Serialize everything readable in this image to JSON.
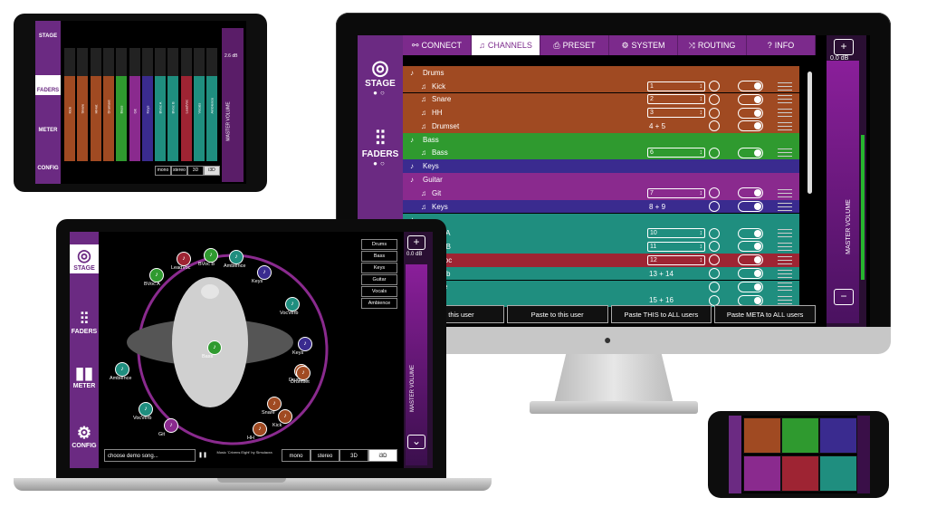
{
  "colors": {
    "purple": "#6b2a82",
    "drums": "#a04a22",
    "bass": "#2f9a2f",
    "keys": "#3a2b8f",
    "guitar": "#8a2a8e",
    "vocals": "#1f8e7f",
    "leadvoc": "#9e2433",
    "meter_green": "#27b32f"
  },
  "desktop": {
    "sidebar": [
      {
        "label": "STAGE",
        "icon": "target-icon"
      },
      {
        "label": "FADERS",
        "icon": "sliders-icon"
      }
    ],
    "tabs": [
      {
        "label": "CONNECT",
        "icon": "link-icon",
        "active": false
      },
      {
        "label": "CHANNELS",
        "icon": "music-icon",
        "active": true
      },
      {
        "label": "PRESET",
        "icon": "save-icon",
        "active": false
      },
      {
        "label": "SYSTEM",
        "icon": "gear-icon",
        "active": false
      },
      {
        "label": "ROUTING",
        "icon": "shuffle-icon",
        "active": false
      },
      {
        "label": "INFO",
        "icon": "help-icon",
        "active": false
      }
    ],
    "rows": [
      {
        "kind": "group",
        "name": "Drums",
        "color": "#a04a22"
      },
      {
        "kind": "sub",
        "name": "Kick",
        "color": "#a04a22",
        "sel": "1"
      },
      {
        "kind": "sub",
        "name": "Snare",
        "color": "#a04a22",
        "sel": "2"
      },
      {
        "kind": "sub",
        "name": "HH",
        "color": "#a04a22",
        "sel": "3"
      },
      {
        "kind": "sub",
        "name": "Drumset",
        "color": "#a04a22",
        "pair": "4 + 5"
      },
      {
        "kind": "group",
        "name": "Bass",
        "color": "#2f9a2f"
      },
      {
        "kind": "sub",
        "name": "Bass",
        "color": "#2f9a2f",
        "sel": "6"
      },
      {
        "kind": "group",
        "name": "Keys",
        "color": "#3a2b8f"
      },
      {
        "kind": "group",
        "name": "Guitar",
        "color": "#8a2a8e"
      },
      {
        "kind": "sub",
        "name": "Git",
        "color": "#8a2a8e",
        "sel": "7"
      },
      {
        "kind": "sub",
        "name": "Keys",
        "color": "#3a2b8f",
        "pair": "8 + 9"
      },
      {
        "kind": "group",
        "name": "",
        "color": "#1f8e7f"
      },
      {
        "kind": "sub",
        "name": "Voc A",
        "color": "#1f8e7f",
        "sel": "10"
      },
      {
        "kind": "sub",
        "name": "Voc B",
        "color": "#1f8e7f",
        "sel": "11"
      },
      {
        "kind": "sub",
        "name": "adVoc",
        "color": "#9e2433",
        "sel": "12"
      },
      {
        "kind": "sub",
        "name": "cVerb",
        "color": "#1f8e7f",
        "pair": "13 + 14"
      },
      {
        "kind": "sub",
        "name": "ence",
        "color": "#1f8e7f"
      },
      {
        "kind": "sub",
        "name": "",
        "color": "#1f8e7f",
        "pair": "15 + 16"
      }
    ],
    "paste_buttons": [
      "from this user",
      "Paste to this user",
      "Paste THIS to ALL users",
      "Paste META to ALL users"
    ],
    "master": {
      "db": "0.0 dB",
      "label": "MASTER VOLUME",
      "level": 0.9
    }
  },
  "tablet": {
    "sidebar": [
      "STAGE",
      "FADERS",
      "METER",
      "CONFIG"
    ],
    "modes": [
      "mono",
      "stereo",
      "3D",
      "i3D"
    ],
    "master_label": "MASTER VOLUME",
    "master_db": "2.6 dB",
    "channels": [
      "Kick",
      "Snare",
      "HiHat",
      "Drumset",
      "Bass",
      "Git",
      "Keys",
      "BVoc A",
      "BVoc B",
      "LeadVoc",
      "Vocals",
      "Ambience"
    ]
  },
  "laptop": {
    "sidebar": [
      "STAGE",
      "FADERS",
      "METER",
      "CONFIG"
    ],
    "groups": [
      "Drums",
      "Bass",
      "Keys",
      "Guitar",
      "Vocals",
      "Ambience"
    ],
    "master": {
      "db": "0.0 dB",
      "label": "MASTER VOLUME"
    },
    "song_select": "choose demo song...",
    "credit": "Music 'Crivens Eight' by Simulacra",
    "modes": [
      "mono",
      "stereo",
      "3D",
      "i3D"
    ],
    "stage_nodes": [
      "BVoc A",
      "LeadVoc",
      "BVoc B",
      "Ambience",
      "Keys",
      "VocVerb",
      "Keys",
      "Drumset",
      "Kick",
      "Snare",
      "HH",
      "Drumset",
      "Git",
      "VocVerb",
      "Ambience",
      "Bass"
    ]
  }
}
